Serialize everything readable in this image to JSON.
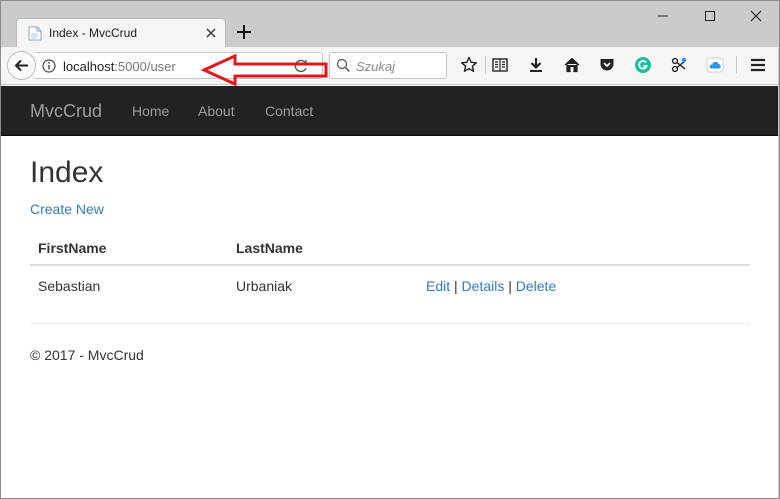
{
  "browser": {
    "tab_title": "Index - MvcCrud",
    "url_host": "localhost",
    "url_rest": ":5000/user",
    "search_placeholder": "Szukaj"
  },
  "site": {
    "brand": "MvcCrud",
    "nav": [
      "Home",
      "About",
      "Contact"
    ]
  },
  "page": {
    "title": "Index",
    "create_link": "Create New",
    "table": {
      "headers": [
        "FirstName",
        "LastName"
      ],
      "rows": [
        {
          "first": "Sebastian",
          "last": "Urbaniak",
          "actions": [
            "Edit",
            "Details",
            "Delete"
          ],
          "separator": "|"
        }
      ]
    },
    "footer": "© 2017 - MvcCrud"
  },
  "icons": {
    "annotation": "red-arrow-icon",
    "back": "back-arrow-icon",
    "info": "info-icon",
    "reload": "reload-icon",
    "search": "search-icon",
    "toolbar": [
      "bookmark-star-icon",
      "reading-list-icon",
      "download-icon",
      "home-icon",
      "pocket-icon",
      "grammarly-icon",
      "extension-icon",
      "cloud-icon",
      "hamburger-menu-icon"
    ]
  },
  "colors": {
    "link": "#337ab7",
    "navbar_bg": "#222222",
    "nav_text": "#9d9d9d",
    "annotation_red": "#e0171c",
    "grammarly_green": "#15c39a",
    "cloud_blue": "#2b95e8"
  }
}
